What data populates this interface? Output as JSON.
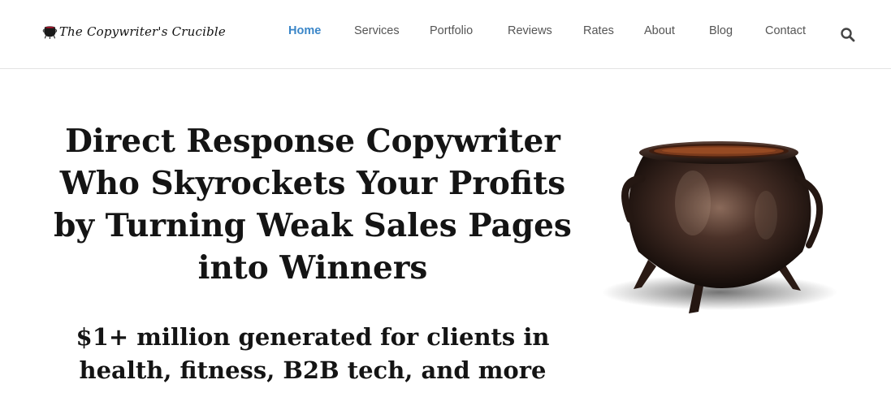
{
  "header": {
    "logo": {
      "text": "The Copywriter's Crucible",
      "icon": "cauldron-icon"
    },
    "nav": {
      "items": [
        {
          "label": "Home",
          "active": true
        },
        {
          "label": "Services",
          "active": false
        },
        {
          "label": "Portfolio",
          "active": false
        },
        {
          "label": "Reviews",
          "active": false
        },
        {
          "label": "Rates",
          "active": false
        },
        {
          "label": "About",
          "active": false
        },
        {
          "label": "Blog",
          "active": false
        },
        {
          "label": "Contact",
          "active": false
        }
      ]
    },
    "search_icon": "search-icon"
  },
  "hero": {
    "headline": "Direct Response Copywriter Who Skyrockets Your Profits by Turning Weak Sales Pages into Winners",
    "subheadline": "$1+ million generated for clients in health, fitness, B2B tech, and more",
    "image_icon": "cauldron-icon"
  },
  "colors": {
    "accent": "#3a86c8",
    "nav_text": "#555555",
    "heading_text": "#141414",
    "divider": "#e4e4e4"
  }
}
